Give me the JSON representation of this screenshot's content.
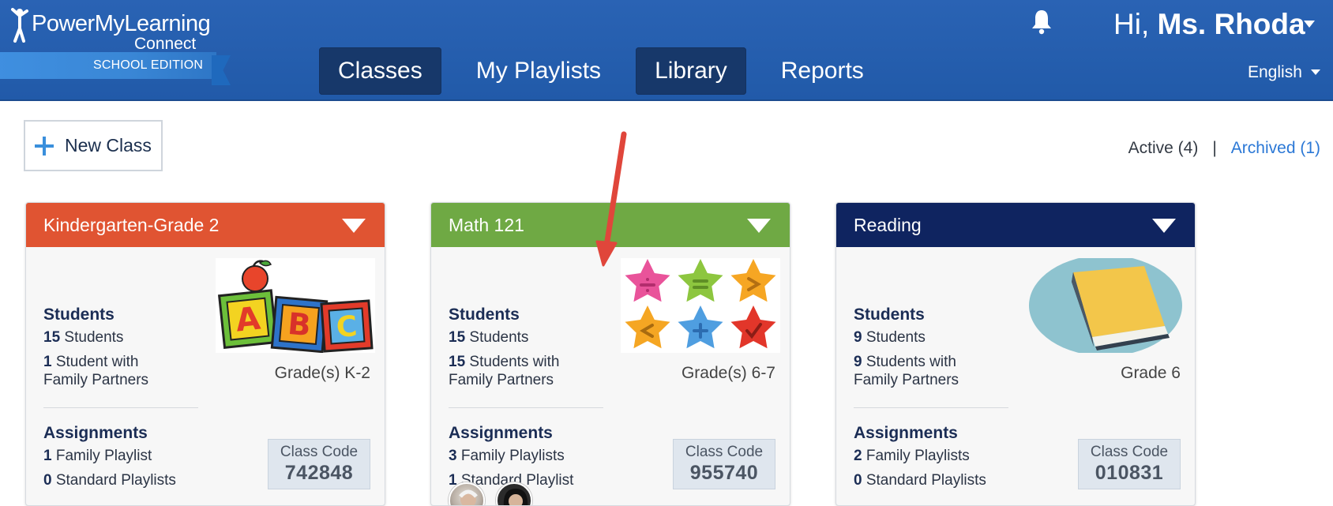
{
  "header": {
    "logo_title": "PowerMyLearning",
    "logo_sub": "Connect",
    "edition": "SCHOOL EDITION",
    "greeting_prefix": "Hi,",
    "user_name": "Ms. Rhoda",
    "language": "English",
    "nav": [
      {
        "label": "Classes",
        "active": true
      },
      {
        "label": "My Playlists",
        "active": false
      },
      {
        "label": "Library",
        "active": true
      },
      {
        "label": "Reports",
        "active": false
      }
    ]
  },
  "toolbar": {
    "new_class_label": "New Class",
    "active_label": "Active (4)",
    "separator": "|",
    "archived_label": "Archived (1)"
  },
  "colors": {
    "header_blue": "#215aa9",
    "kinder_head": "#e05432",
    "math_head": "#6fa944",
    "reading_head": "#0f2460",
    "link_blue": "#2b78d6"
  },
  "cards": [
    {
      "title": "Kindergarten-Grade 2",
      "students_heading": "Students",
      "students_count": "15",
      "students_label": "Students",
      "family_count": "1",
      "family_label_1": "Student with",
      "family_label_2": "Family Partners",
      "grade": "Grade(s) K-2",
      "assignments_heading": "Assignments",
      "family_playlists_count": "1",
      "family_playlists_label": "Family Playlist",
      "standard_playlists_count": "0",
      "standard_playlists_label": "Standard Playlists",
      "code_label": "Class Code",
      "code": "742848",
      "image": "abc-blocks-icon"
    },
    {
      "title": "Math 121",
      "students_heading": "Students",
      "students_count": "15",
      "students_label": "Students",
      "family_count": "15",
      "family_label_1": "Students with",
      "family_label_2": "Family Partners",
      "grade": "Grade(s) 6-7",
      "assignments_heading": "Assignments",
      "family_playlists_count": "3",
      "family_playlists_label": "Family Playlists",
      "standard_playlists_count": "1",
      "standard_playlists_label": "Standard Playlist",
      "code_label": "Class Code",
      "code": "955740",
      "image": "math-stars-icon"
    },
    {
      "title": "Reading",
      "students_heading": "Students",
      "students_count": "9",
      "students_label": "Students",
      "family_count": "9",
      "family_label_1": "Students with",
      "family_label_2": "Family Partners",
      "grade": "Grade 6",
      "assignments_heading": "Assignments",
      "family_playlists_count": "2",
      "family_playlists_label": "Family Playlists",
      "standard_playlists_count": "0",
      "standard_playlists_label": "Standard Playlists",
      "code_label": "Class Code",
      "code": "010831",
      "image": "book-icon"
    }
  ]
}
